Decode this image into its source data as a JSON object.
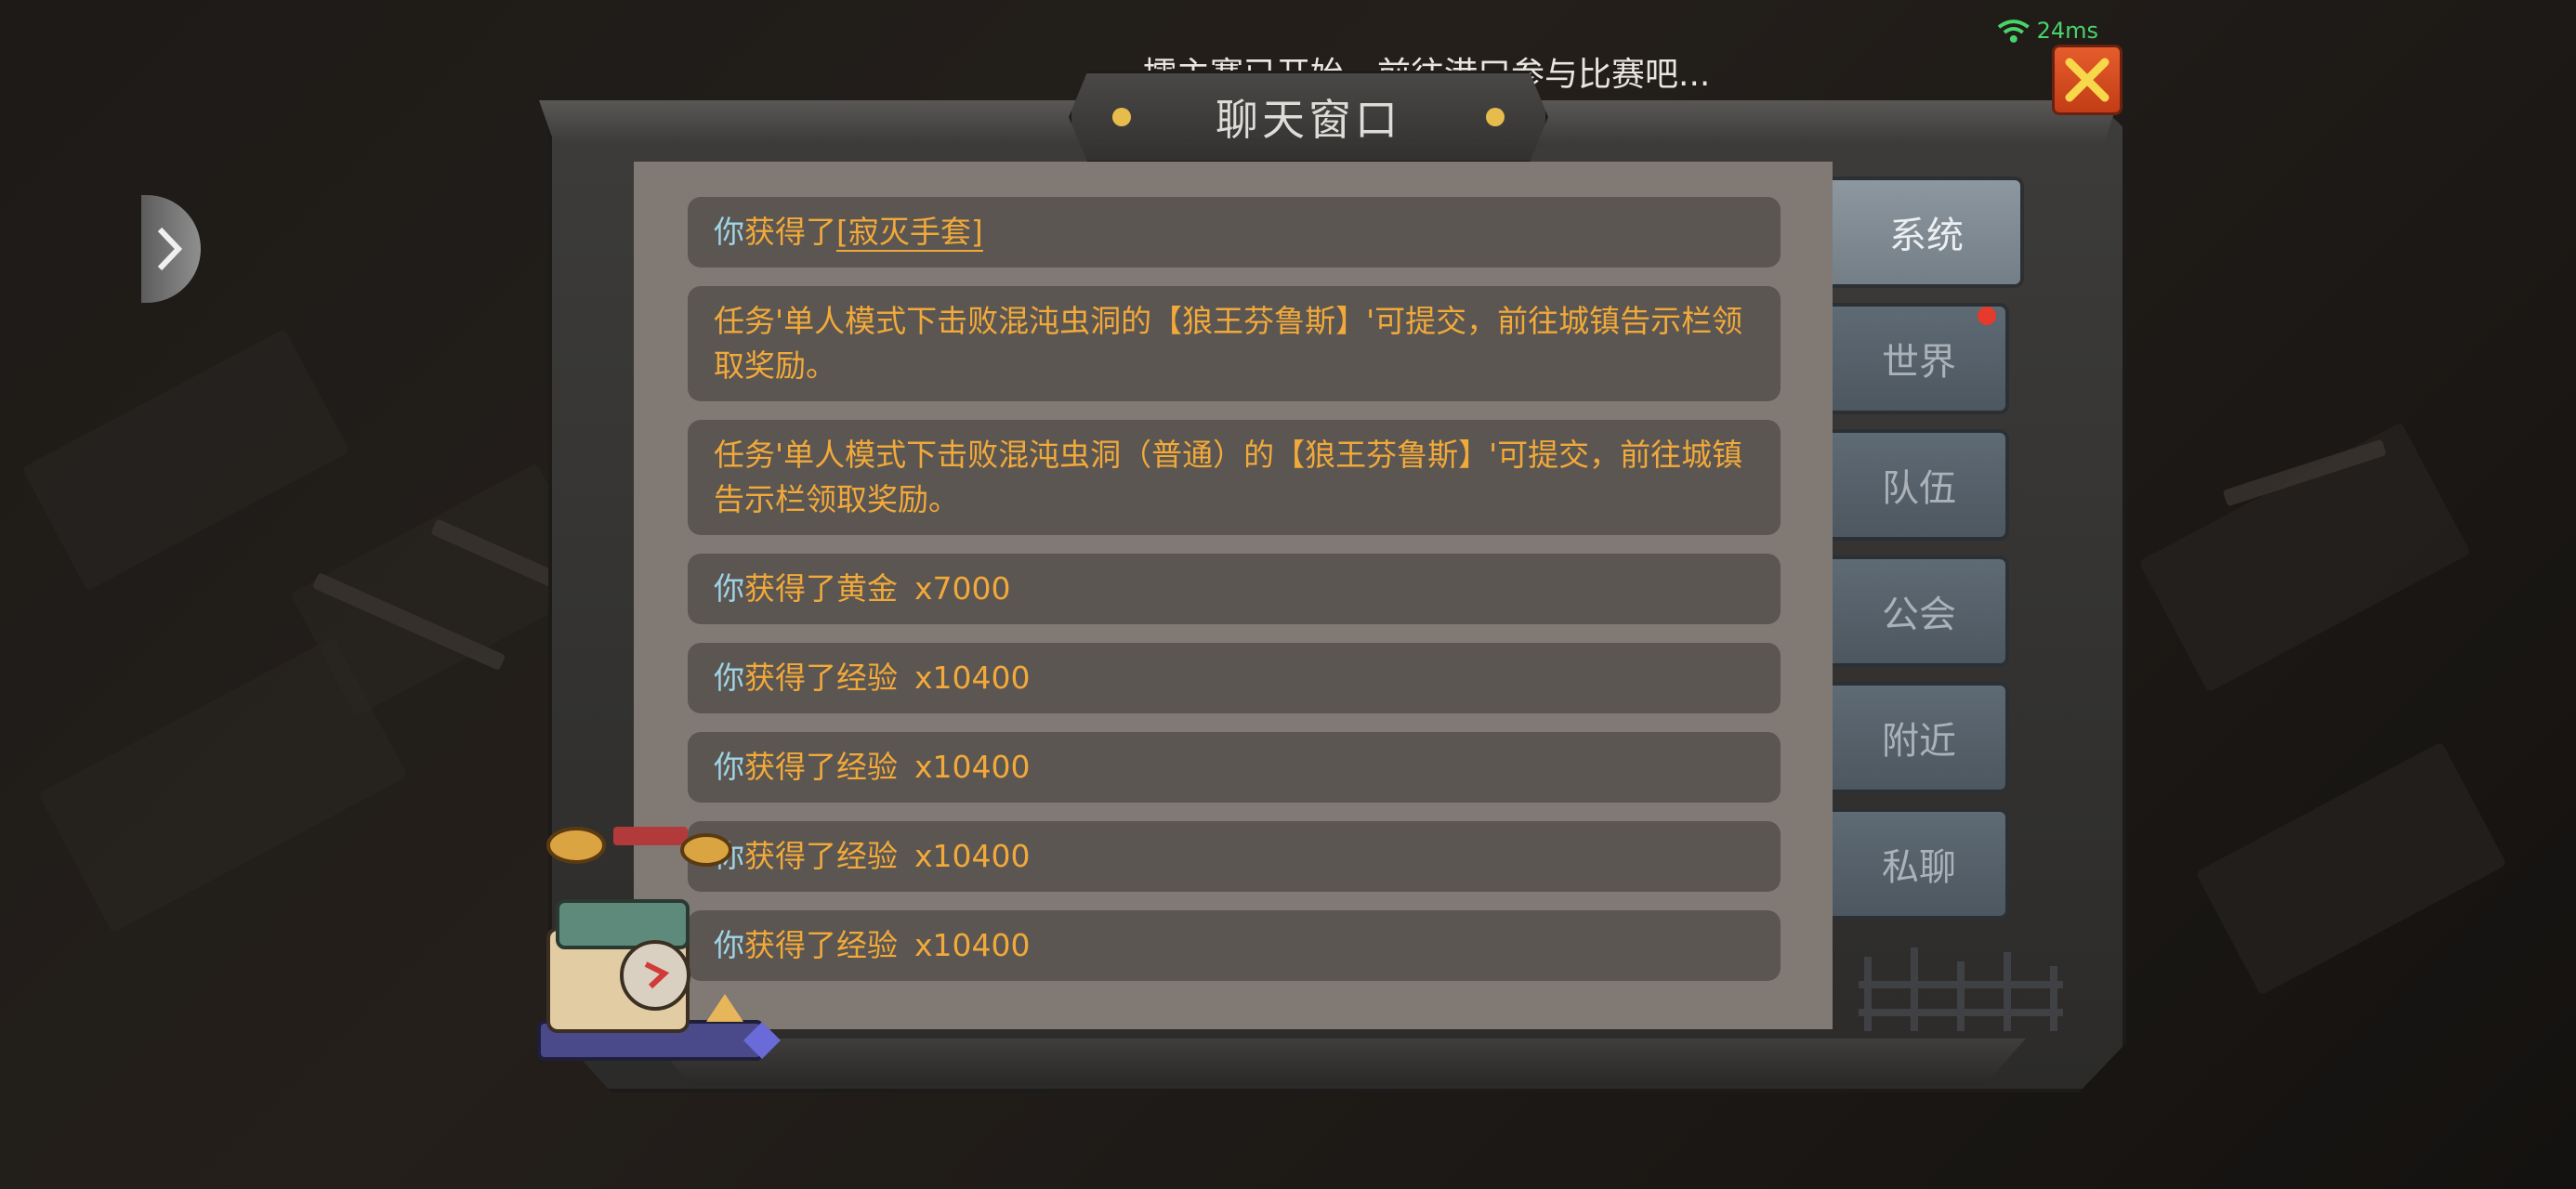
{
  "marquee": "擂主赛已开始，前往港口参与比赛吧...",
  "status": {
    "ping": "24ms",
    "wifi_color": "#49d36b"
  },
  "window": {
    "title": "聊天窗口"
  },
  "messages": [
    {
      "you": "你",
      "text": "获得了",
      "item": "[寂灭手套]"
    },
    {
      "text": "任务'单人模式下击败混沌虫洞的【狼王芬鲁斯】'可提交，前往城镇告示栏领取奖励。"
    },
    {
      "text": "任务'单人模式下击败混沌虫洞（普通）的【狼王芬鲁斯】'可提交，前往城镇告示栏领取奖励。"
    },
    {
      "you": "你",
      "text": "获得了黄金",
      "qty": "x7000"
    },
    {
      "you": "你",
      "text": "获得了经验",
      "qty": "x10400"
    },
    {
      "you": "你",
      "text": "获得了经验",
      "qty": "x10400"
    },
    {
      "you": "你",
      "text": "获得了经验",
      "qty": "x10400"
    },
    {
      "you": "你",
      "text": "获得了经验",
      "qty": "x10400"
    }
  ],
  "tabs": [
    {
      "label": "系统",
      "active": true
    },
    {
      "label": "世界",
      "active": false,
      "has_notification": true
    },
    {
      "label": "队伍",
      "active": false
    },
    {
      "label": "公会",
      "active": false
    },
    {
      "label": "附近",
      "active": false
    },
    {
      "label": "私聊",
      "active": false
    }
  ],
  "colors": {
    "reward_text": "#f1a93a",
    "player_you": "#9fd4e6",
    "close_button": "#e65d2c",
    "notification": "#e53a2c"
  },
  "icons": {
    "close": "close-x-icon",
    "expand": "chevron-right-icon",
    "signal": "wifi-icon"
  }
}
